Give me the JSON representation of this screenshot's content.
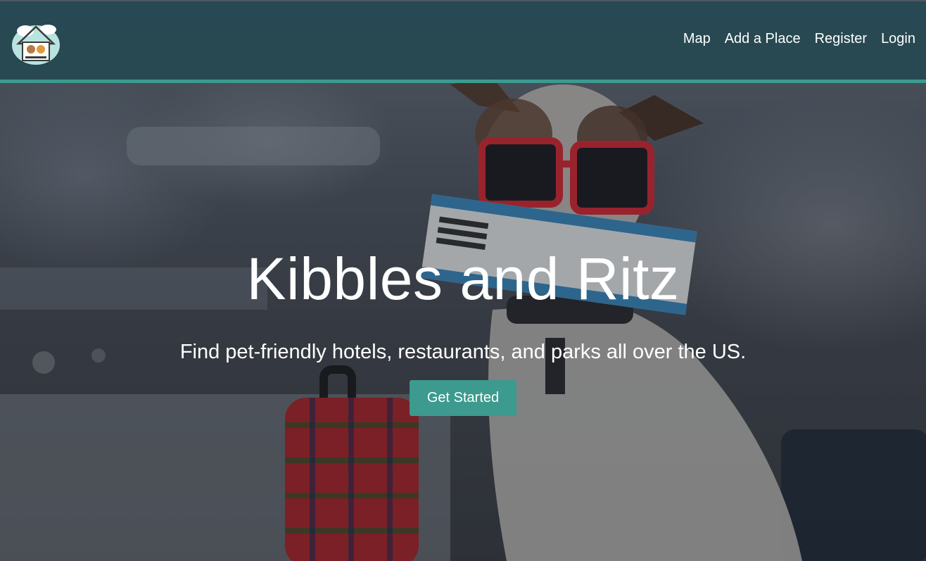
{
  "nav": {
    "logo_alt": "Kibbles and Ritz logo",
    "links": [
      {
        "label": "Map"
      },
      {
        "label": "Add a Place"
      },
      {
        "label": "Register"
      },
      {
        "label": "Login"
      }
    ]
  },
  "hero": {
    "title": "Kibbles and Ritz",
    "subtitle": "Find pet-friendly hotels, restaurants, and parks all over the US.",
    "cta_label": "Get Started"
  },
  "colors": {
    "navbar_bg": "#264852",
    "accent": "#3c9a8e",
    "text": "#ffffff"
  },
  "icons": {
    "logo": "pet-house-logo-icon"
  }
}
